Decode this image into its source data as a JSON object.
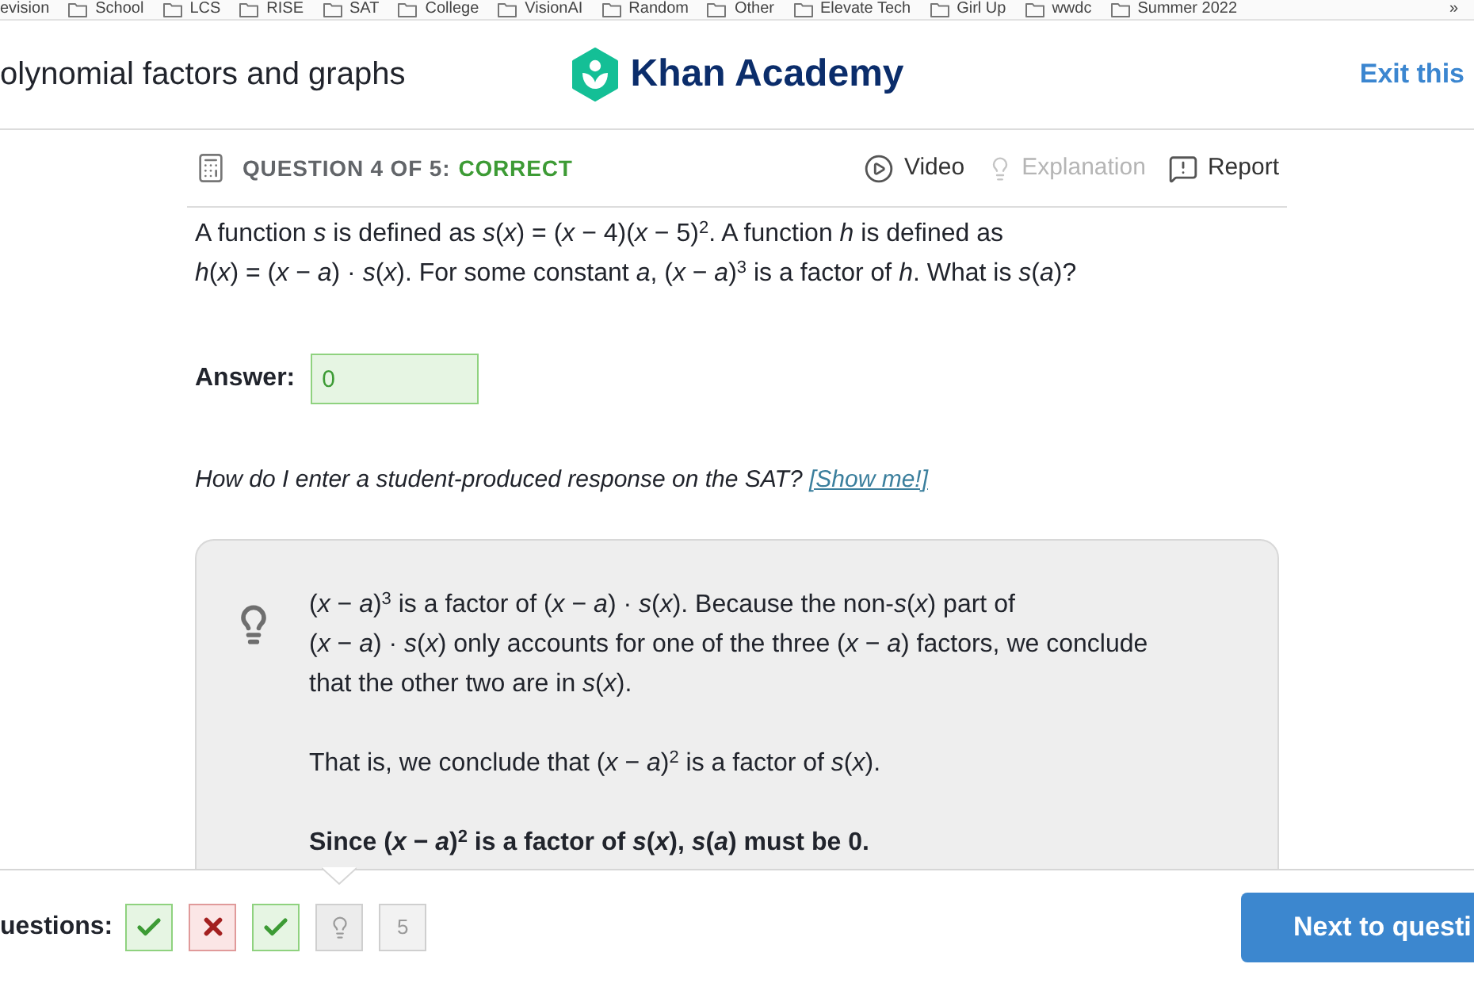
{
  "bookmarks_bar": {
    "items": [
      {
        "label": "evision",
        "kind": "text"
      },
      {
        "label": "School",
        "kind": "folder"
      },
      {
        "label": "LCS",
        "kind": "folder"
      },
      {
        "label": "RISE",
        "kind": "folder"
      },
      {
        "label": "SAT",
        "kind": "folder"
      },
      {
        "label": "College",
        "kind": "folder"
      },
      {
        "label": "VisionAI",
        "kind": "folder"
      },
      {
        "label": "Random",
        "kind": "folder"
      },
      {
        "label": "Other",
        "kind": "folder"
      },
      {
        "label": "Elevate Tech",
        "kind": "folder"
      },
      {
        "label": "Girl Up",
        "kind": "folder"
      },
      {
        "label": "wwdc",
        "kind": "folder"
      },
      {
        "label": "Summer 2022",
        "kind": "folder"
      }
    ],
    "overflow": "»"
  },
  "header": {
    "title": "olynomial factors and graphs",
    "logo": "Khan Academy",
    "exit_link": "Exit this"
  },
  "question": {
    "counter": "QUESTION 4 OF 5:",
    "status": {
      "label": "CORRECT",
      "kind": "correct"
    },
    "actions": [
      {
        "label": "Video",
        "kind": "video",
        "disabled": false
      },
      {
        "label": "Explanation",
        "kind": "explanation",
        "disabled": true
      },
      {
        "label": "Report",
        "kind": "report",
        "disabled": false
      }
    ],
    "text_lines": [
      "A function *s* is defined as *s*(*x*) = (*x* − 4)(*x* − 5)$^{2}$. A function *h* is defined as",
      "*h*(*x*) = (*x* − *a*) · *s*(*x*). For some constant *a*, (*x* − *a*)$^{3}$ is a factor of *h*. What is *s*(*a*)?"
    ],
    "answer": {
      "label": "Answer:",
      "value": "0",
      "correct": true
    },
    "help": {
      "text": "How do I enter a student-produced response on the SAT?",
      "link": "[Show me!]"
    }
  },
  "hint": {
    "paragraphs": [
      {
        "lines": [
          "(*x* − *a*)$^{3}$ is a factor of (*x* − *a*) · *s*(*x*). Because the non-*s*(*x*) part of",
          "(*x* − *a*) · *s*(*x*) only accounts for one of the three (*x* − *a*) factors, we conclude",
          "that the other two are in *s*(*x*)."
        ],
        "bold": false
      },
      {
        "lines": [
          "That is, we conclude that (*x* − *a*)$^{2}$ is a factor of *s*(*x*)."
        ],
        "bold": false
      },
      {
        "lines": [
          "Since (*x* − *a*)$^{2}$ is a factor of *s*(*x*), *s*(*a*) must be 0."
        ],
        "bold": true
      }
    ]
  },
  "progress": {
    "label": "uestions:",
    "items": [
      {
        "kind": "correct",
        "selected": false
      },
      {
        "kind": "incorrect",
        "selected": false
      },
      {
        "kind": "correct",
        "selected": false
      },
      {
        "kind": "hint",
        "selected": true
      },
      {
        "kind": "number",
        "label": "5",
        "selected": false
      }
    ]
  },
  "next_button": "Next to questi"
}
